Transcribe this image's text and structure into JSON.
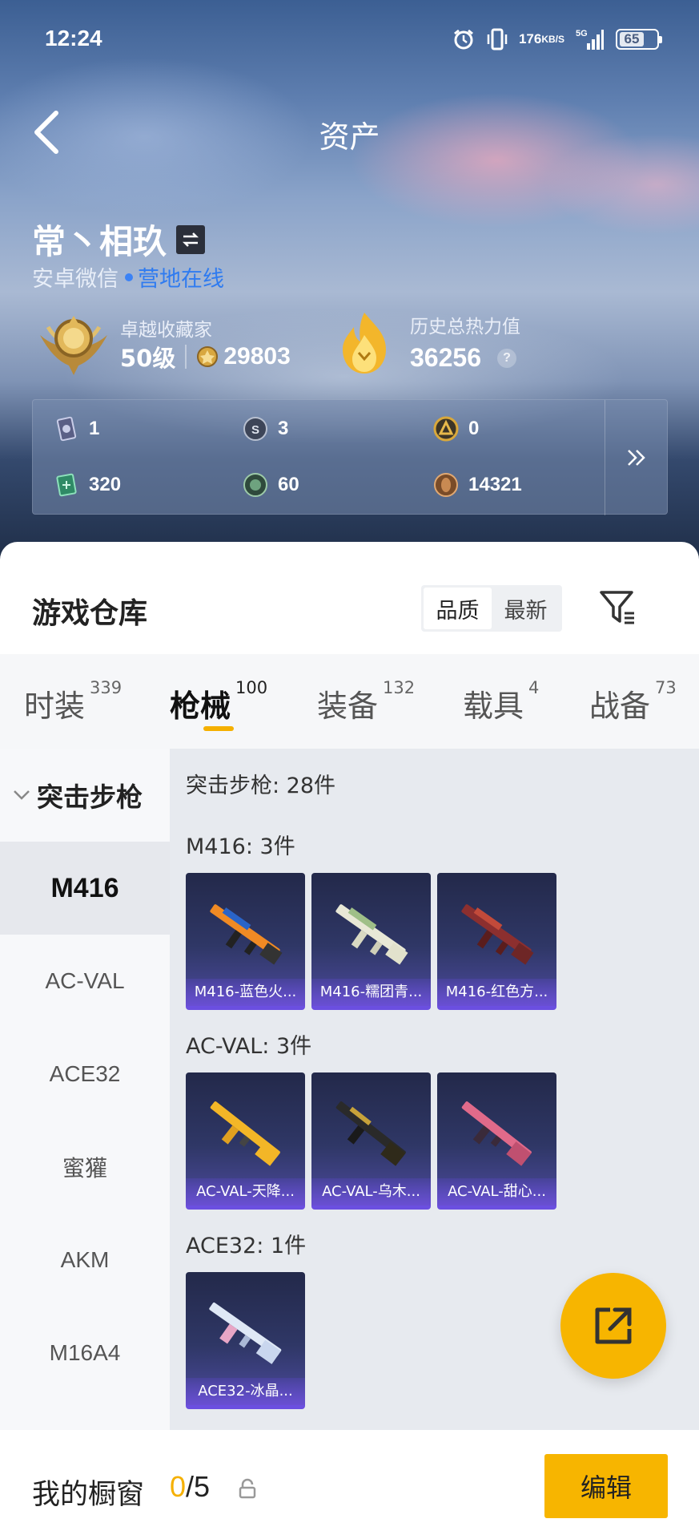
{
  "status_bar": {
    "time": "12:24",
    "net_speed": "176",
    "net_unit": "KB/S",
    "network": "5G",
    "battery": "65"
  },
  "header": {
    "title": "资产"
  },
  "user": {
    "name": "常丶相玖",
    "platform": "安卓微信",
    "online_status": "营地在线"
  },
  "collector": {
    "label": "卓越收藏家",
    "level": "50级",
    "points": "29803"
  },
  "heat": {
    "label": "历史总热力值",
    "value": "36256"
  },
  "currencies": [
    {
      "icon": "card-icon",
      "value": "1"
    },
    {
      "icon": "silver-coin-icon",
      "value": "3"
    },
    {
      "icon": "gold-badge-icon",
      "value": "0"
    },
    {
      "icon": "ticket-icon",
      "value": "320"
    },
    {
      "icon": "green-coin-icon",
      "value": "60"
    },
    {
      "icon": "bronze-coin-icon",
      "value": "14321"
    }
  ],
  "warehouse": {
    "title": "游戏仓库",
    "sort_options": [
      "品质",
      "最新"
    ],
    "sort_selected": "品质"
  },
  "categories": [
    {
      "label": "时装",
      "count": "339"
    },
    {
      "label": "枪械",
      "count": "100",
      "active": true
    },
    {
      "label": "装备",
      "count": "132"
    },
    {
      "label": "载具",
      "count": "4"
    },
    {
      "label": "战备",
      "count": "73"
    }
  ],
  "side_nav": {
    "group": "突击步枪",
    "items": [
      "M416",
      "AC-VAL",
      "ACE32",
      "蜜獾",
      "AKM",
      "M16A4"
    ],
    "selected": "M416"
  },
  "content": {
    "summary": "突击步枪: 28件",
    "sections": [
      {
        "title": "M416: 3件",
        "items": [
          "M416-蓝色火...",
          "M416-糯团青...",
          "M416-红色方..."
        ]
      },
      {
        "title": "AC-VAL: 3件",
        "items": [
          "AC-VAL-天降...",
          "AC-VAL-乌木...",
          "AC-VAL-甜心..."
        ]
      },
      {
        "title": "ACE32: 1件",
        "items": [
          "ACE32-冰晶..."
        ]
      }
    ]
  },
  "showcase": {
    "label": "我的橱窗",
    "current": "0",
    "max": "/5",
    "edit_label": "编辑"
  },
  "colors": {
    "accent": "#f5b000",
    "card_border": "#6b4fe0",
    "online": "#2f7bf0"
  }
}
